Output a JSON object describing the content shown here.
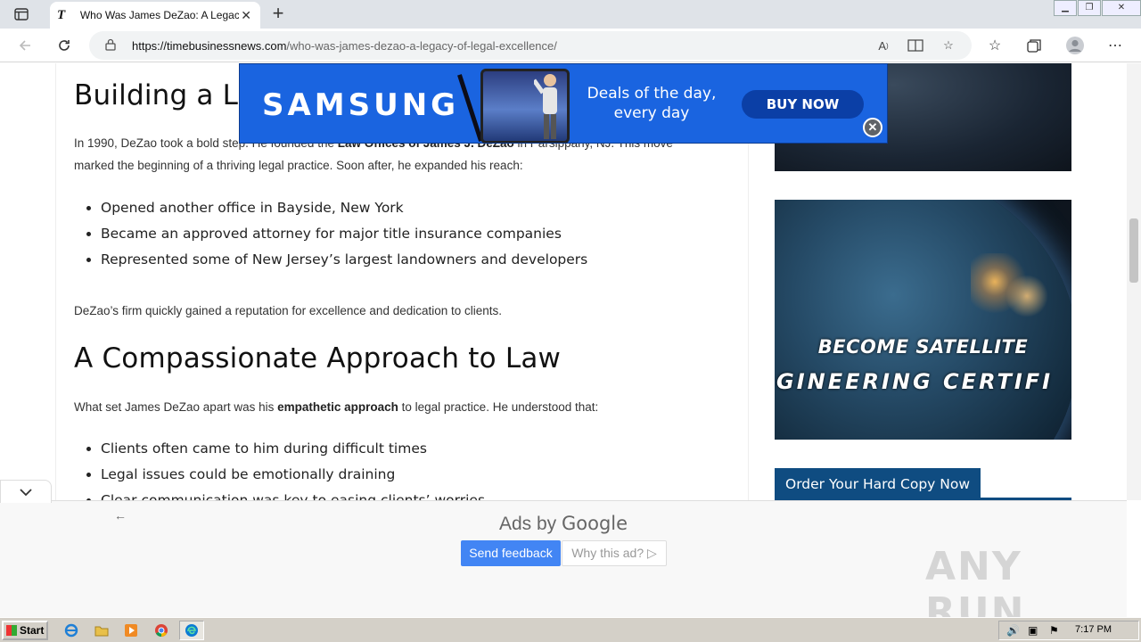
{
  "browser": {
    "tab_title": "Who Was James DeZao: A Legacy",
    "tab_favicon": "T",
    "url_host": "https://timebusinessnews.com",
    "url_path": "/who-was-james-dezao-a-legacy-of-legal-excellence/"
  },
  "article": {
    "heading1": "Building a Le",
    "p1_a": "In 1990, DeZao took a bold step. He founded the ",
    "p1_bold": "Law Offices of James J. DeZao",
    "p1_b": " in Parsippany, NJ. This move",
    "p1_line2": "marked the beginning of a thriving legal practice. Soon after, he expanded his reach:",
    "bullets1": [
      "Opened another office in Bayside, New York",
      "Became an approved attorney for major title insurance companies",
      "Represented some of New Jersey’s largest landowners and developers"
    ],
    "p2": "DeZao’s firm quickly gained a reputation for excellence and dedication to clients.",
    "heading2": "A Compassionate Approach to Law",
    "p3_a": "What set James DeZao apart was his ",
    "p3_bold": "empathetic approach",
    "p3_b": " to legal practice. He understood that:",
    "bullets2": [
      "Clients often came to him during difficult times",
      "Legal issues could be emotionally draining",
      "Clear communication was key to easing clients’ worries"
    ]
  },
  "sidebar": {
    "banner_line1": "BECOME SATELLITE",
    "banner_line2": "GINEERING CERTIFI",
    "order_label": "Order Your Hard Copy Now"
  },
  "top_ad": {
    "brand": "SAMSUNG",
    "tagline_line1": "Deals of the day,",
    "tagline_line2": "every day",
    "cta": "BUY NOW",
    "close": "✕",
    "brand_color": "#1a64e0"
  },
  "anchor_ad": {
    "ads_by": "Ads by ",
    "google": "Google",
    "send_feedback": "Send feedback",
    "why_ad": "Why this ad? ▷"
  },
  "watermark": "ANY RUN",
  "taskbar": {
    "start": "Start",
    "clock": "7:17 PM"
  }
}
